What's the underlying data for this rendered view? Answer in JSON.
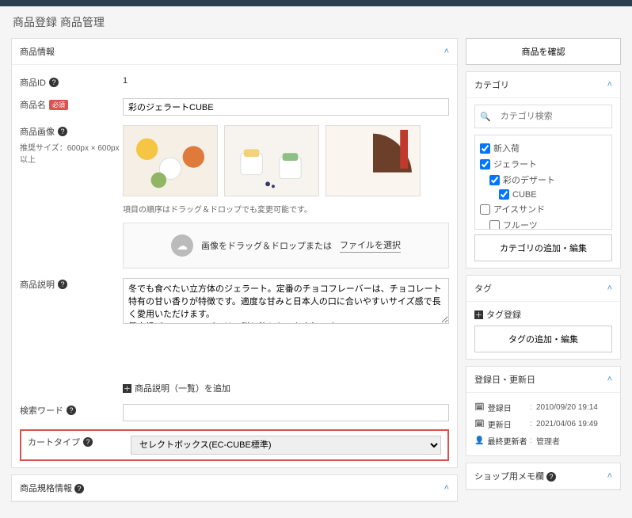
{
  "page_title": "商品登録 商品管理",
  "main": {
    "panel1_title": "商品情報",
    "rows": {
      "id_label": "商品ID",
      "id_value": "1",
      "name_label": "商品名",
      "name_required": "必須",
      "name_value": "彩のジェラートCUBE",
      "images_label": "商品画像",
      "images_hint": "推奨サイズ：600px × 600px以上",
      "drag_hint": "項目の順序はドラッグ＆ドロップでも変更可能です。",
      "drop_text": "画像をドラッグ＆ドロップまたは",
      "file_link": "ファイルを選択",
      "desc_label": "商品説明",
      "desc_value": "冬でも食べたい立方体のジェラート。定番のチョコフレーバーは、チョコレート特有の甘い香りが特徴です。適度な甘みと日本人の口に合いやすいサイズ感で長く愛用いただけます。\n最高級バニラフレーバーは、贈り物としても人気です。",
      "add_desc": "商品説明（一覧）を追加",
      "search_word_label": "検索ワード",
      "cart_type_label": "カートタイプ",
      "cart_type_value": "セレクトボックス(EC-CUBE標準)"
    },
    "panel2_title": "商品規格情報"
  },
  "side": {
    "confirm_btn": "商品を確認",
    "cat_title": "カテゴリ",
    "cat_search_ph": "カテゴリ検索",
    "cats": [
      {
        "label": "新入荷",
        "checked": true,
        "indent": 0
      },
      {
        "label": "ジェラート",
        "checked": true,
        "indent": 0
      },
      {
        "label": "彩のデザート",
        "checked": true,
        "indent": 1
      },
      {
        "label": "CUBE",
        "checked": true,
        "indent": 2
      },
      {
        "label": "アイスサンド",
        "checked": false,
        "indent": 0
      },
      {
        "label": "フルーツ",
        "checked": false,
        "indent": 1
      }
    ],
    "cat_edit_btn": "カテゴリの追加・編集",
    "tag_title": "タグ",
    "tag_link": "タグ登録",
    "tag_edit_btn": "タグの追加・編集",
    "dates_title": "登録日・更新日",
    "created_label": "登録日",
    "created_value": "2010/09/20 19:14",
    "updated_label": "更新日",
    "updated_value": "2021/04/06 19:49",
    "updater_label": "最終更新者",
    "updater_value": "管理者",
    "memo_title": "ショップ用メモ欄"
  }
}
